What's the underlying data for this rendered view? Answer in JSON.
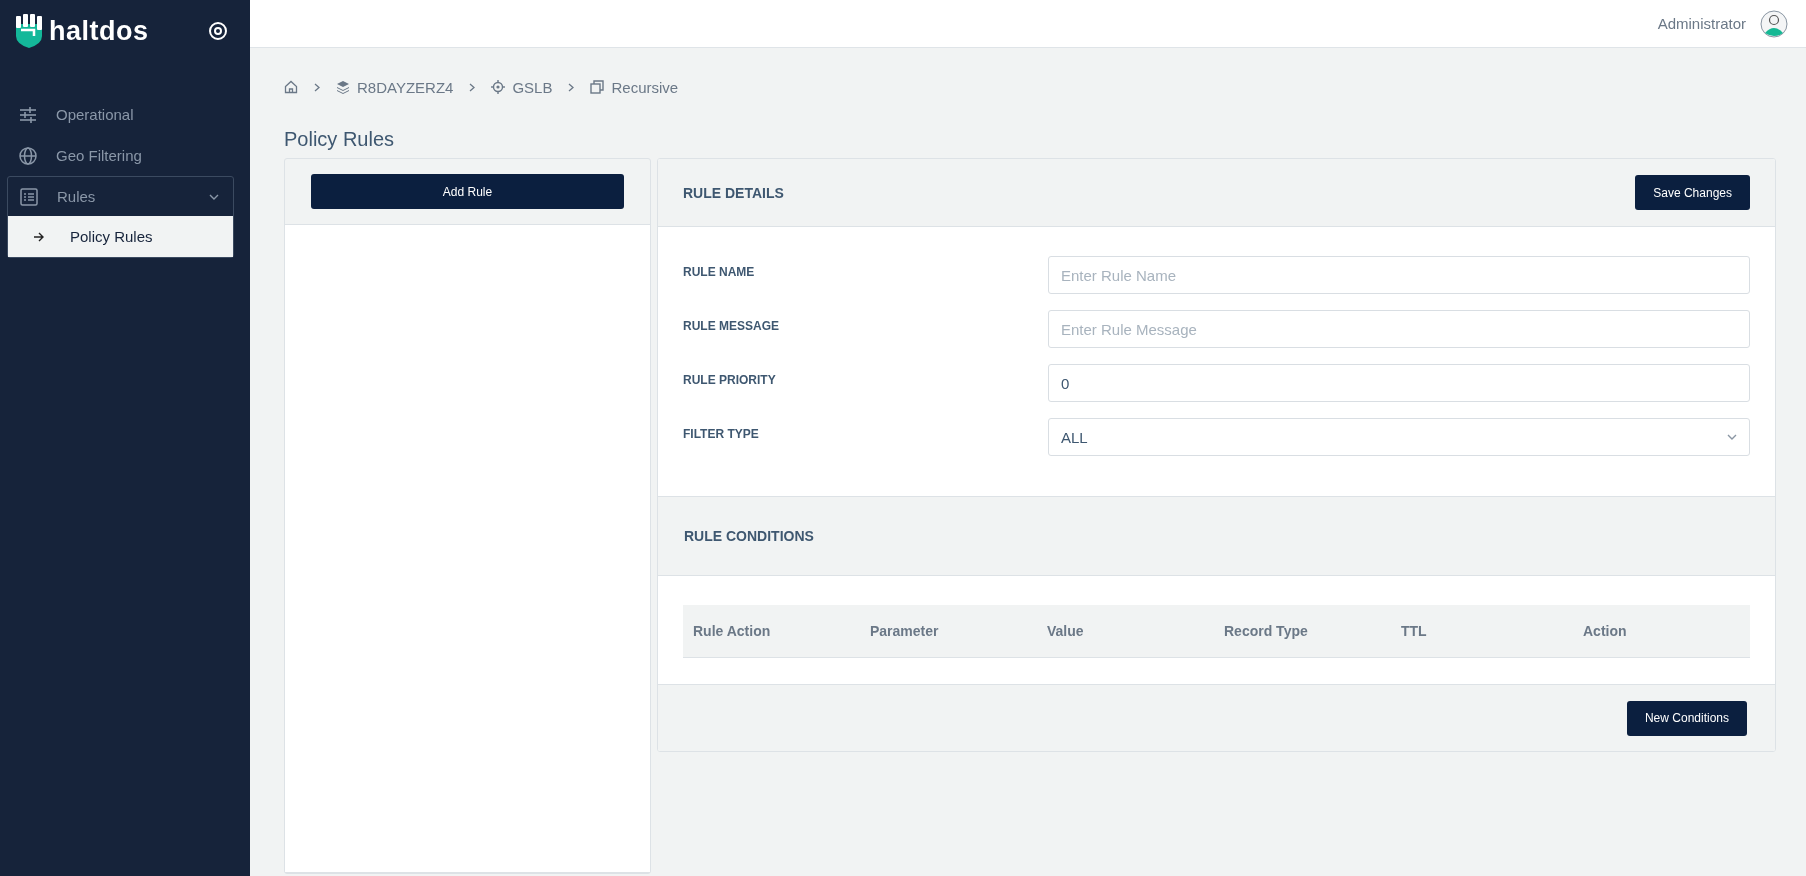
{
  "sidebar": {
    "logo": "haltdos",
    "nav": [
      {
        "label": "Operational",
        "selected": false
      },
      {
        "label": "Geo Filtering",
        "selected": false
      },
      {
        "label": "Rules",
        "selected": false,
        "expanded": true,
        "children": [
          {
            "label": "Policy Rules",
            "selected": true
          }
        ]
      }
    ]
  },
  "header": {
    "user": "Administrator"
  },
  "breadcrumb": [
    "R8DAYZERZ4",
    "GSLB",
    "Recursive"
  ],
  "page_title": "Policy Rules",
  "rules_list": {
    "add_button": "Add Rule"
  },
  "rule_details": {
    "title": "RULE DETAILS",
    "save_button": "Save Changes",
    "fields": [
      {
        "label": "RULE NAME",
        "kind": "text",
        "placeholder": "Enter Rule Name"
      },
      {
        "label": "RULE MESSAGE",
        "kind": "text",
        "placeholder": "Enter Rule Message"
      },
      {
        "label": "RULE PRIORITY",
        "kind": "text",
        "value": "0"
      },
      {
        "label": "FILTER TYPE",
        "kind": "select",
        "value": "ALL"
      }
    ]
  },
  "rule_conditions": {
    "title": "RULE CONDITIONS",
    "table": {
      "columns": [
        "Rule Action",
        "Parameter",
        "Value",
        "Record Type",
        "TTL",
        "Action"
      ]
    },
    "new_button": "New Conditions"
  }
}
